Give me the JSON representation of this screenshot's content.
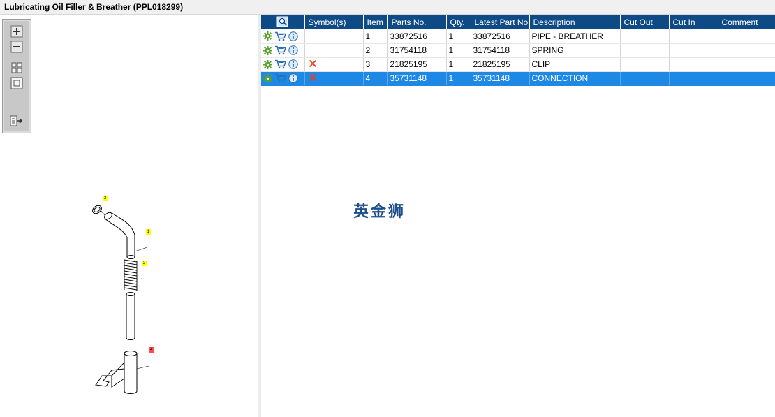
{
  "window": {
    "title": "Lubricating Oil Filler & Breather (PPL018299)"
  },
  "toolbar": {
    "buttons": [
      {
        "name": "zoom-in-icon"
      },
      {
        "name": "zoom-out-icon"
      },
      {
        "name": "fit-all-icon"
      },
      {
        "name": "fit-window-icon"
      },
      {
        "name": "export-icon"
      }
    ]
  },
  "drawing": {
    "callouts": [
      {
        "label": "3",
        "color": "#ffff00"
      },
      {
        "label": "1",
        "color": "#ffff00"
      },
      {
        "label": "2",
        "color": "#ffff00"
      },
      {
        "label": "4",
        "color": "#ff4d4d"
      }
    ]
  },
  "table": {
    "headers": {
      "search_icon": "search-list-icon",
      "symbols": "Symbol(s)",
      "item": "Item",
      "part_no": "Parts No.",
      "qty": "Qty.",
      "latest_part_no": "Latest Part No.",
      "description": "Description",
      "cut_out": "Cut Out",
      "cut_in": "Cut In",
      "comment": "Comment"
    },
    "rows": [
      {
        "item": "1",
        "part_no": "33872516",
        "qty": "1",
        "latest_part_no": "33872516",
        "description": "PIPE - BREATHER",
        "cut_out": "",
        "cut_in": "",
        "comment": "",
        "has_symbol": false,
        "selected": false
      },
      {
        "item": "2",
        "part_no": "31754118",
        "qty": "1",
        "latest_part_no": "31754118",
        "description": "SPRING",
        "cut_out": "",
        "cut_in": "",
        "comment": "",
        "has_symbol": false,
        "selected": false
      },
      {
        "item": "3",
        "part_no": "21825195",
        "qty": "1",
        "latest_part_no": "21825195",
        "description": "CLIP",
        "cut_out": "",
        "cut_in": "",
        "comment": "",
        "has_symbol": true,
        "selected": false
      },
      {
        "item": "4",
        "part_no": "35731148",
        "qty": "1",
        "latest_part_no": "35731148",
        "description": "CONNECTION",
        "cut_out": "",
        "cut_in": "",
        "comment": "",
        "has_symbol": true,
        "selected": true
      }
    ]
  },
  "watermark": {
    "text": "英金狮"
  },
  "colors": {
    "header_bg": "#0e4a86",
    "selected_row": "#1e88e5",
    "gear_green": "#5aa02c",
    "cart_blue": "#2a6fb5",
    "info_blue": "#2a6fb5",
    "symbol_red": "#e8401c",
    "callout_yellow": "#ffff00",
    "callout_red": "#ff4d4d"
  }
}
